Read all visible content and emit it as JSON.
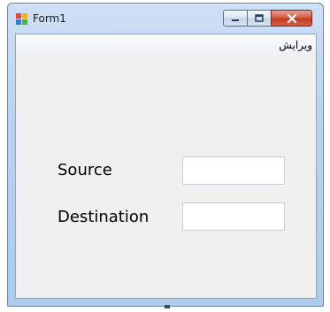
{
  "window": {
    "title": "Form1",
    "min_symbol": "▁",
    "max_symbol": "▢",
    "close_symbol": "✕"
  },
  "menu": {
    "items": [
      {
        "label": "ویرایش"
      }
    ]
  },
  "form": {
    "source_label": "Source",
    "source_value": "",
    "destination_label": "Destination",
    "destination_value": ""
  },
  "colors": {
    "window_frame": "#b9d1ee",
    "client_bg": "#f0f0f0",
    "close_button": "#c23b22"
  }
}
